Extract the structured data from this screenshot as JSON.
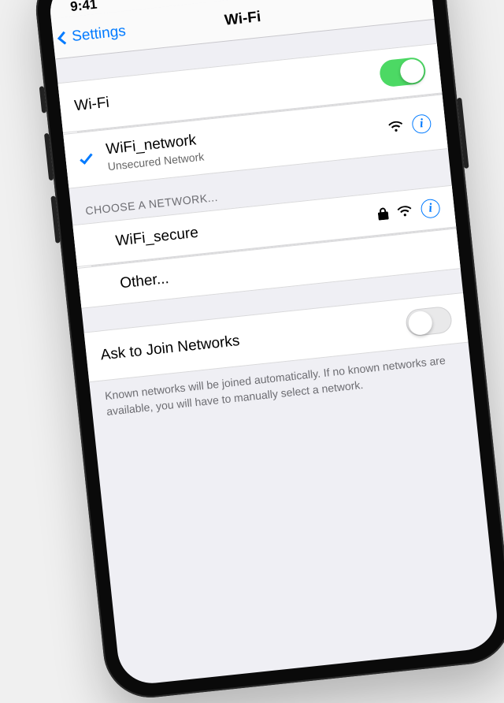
{
  "status": {
    "time": "9:41"
  },
  "nav": {
    "back_label": "Settings",
    "title": "Wi-Fi"
  },
  "wifi_switch": {
    "label": "Wi-Fi",
    "on": true
  },
  "connected": {
    "ssid": "WiFi_network",
    "detail": "Unsecured Network"
  },
  "choose_header": "Choose a Network...",
  "networks": [
    {
      "ssid": "WiFi_secure",
      "locked": true
    }
  ],
  "other_label": "Other...",
  "ask_join": {
    "label": "Ask to Join Networks",
    "on": false,
    "footer": "Known networks will be joined automatically. If no known networks are available, you will have to manually select a network."
  }
}
